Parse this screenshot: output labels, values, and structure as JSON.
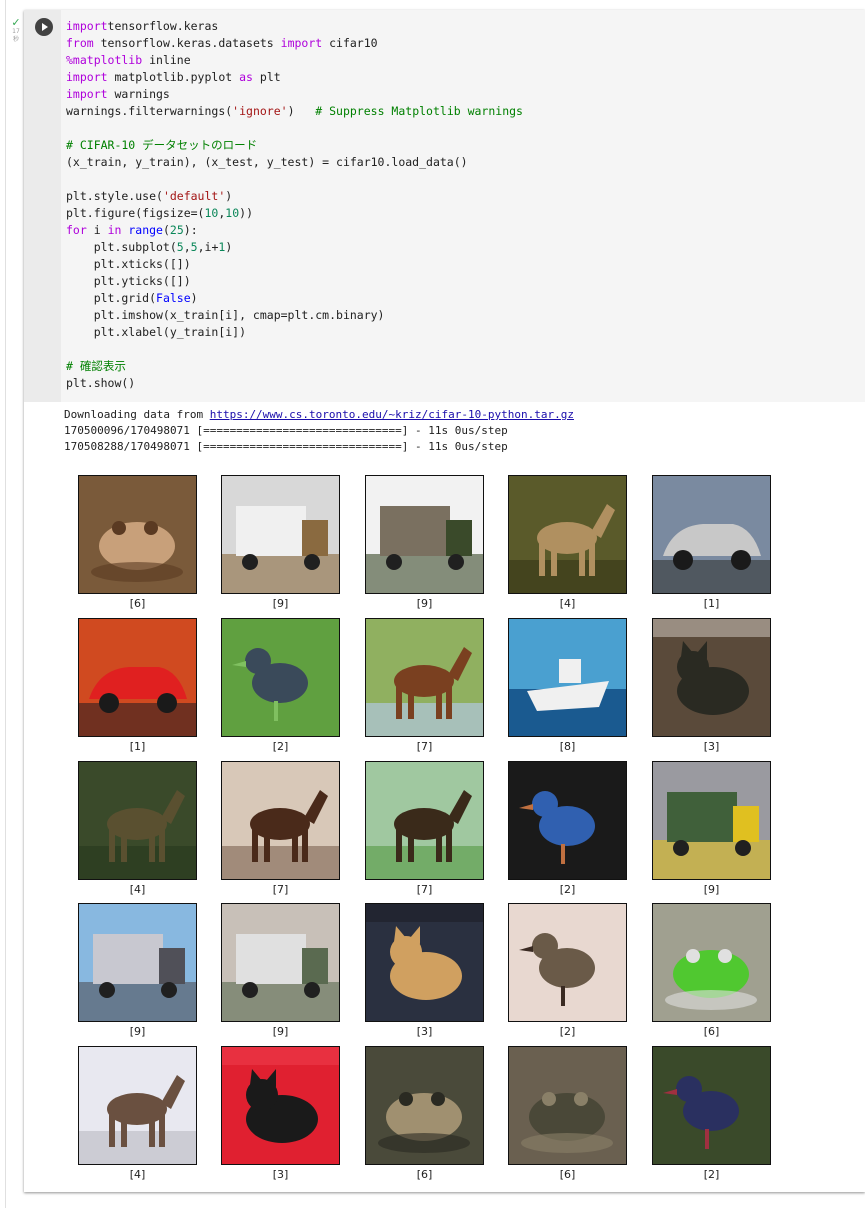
{
  "cell": {
    "status_lines": [
      "17",
      "秒"
    ],
    "code_lines": [
      [
        [
          "kw",
          "import"
        ],
        [
          "",
          "tensorflow.keras"
        ]
      ],
      [
        [
          "kw",
          "from"
        ],
        [
          "",
          " tensorflow.keras.datasets "
        ],
        [
          "kw",
          "import"
        ],
        [
          "",
          " cifar10"
        ]
      ],
      [
        [
          "kw",
          "%matplotlib"
        ],
        [
          "",
          " inline"
        ]
      ],
      [
        [
          "kw",
          "import"
        ],
        [
          "",
          " matplotlib.pyplot "
        ],
        [
          "kw",
          "as"
        ],
        [
          "",
          " plt"
        ]
      ],
      [
        [
          "kw",
          "import"
        ],
        [
          "",
          " warnings"
        ]
      ],
      [
        [
          "",
          "warnings.filterwarnings("
        ],
        [
          "st",
          "'ignore'"
        ],
        [
          "",
          ")   "
        ],
        [
          "cm",
          "# Suppress Matplotlib warnings"
        ]
      ],
      [],
      [
        [
          "cm",
          "# CIFAR-10 データセットのロード"
        ]
      ],
      [
        [
          "",
          "(x_train, y_train), (x_test, y_test) = cifar10.load_data()"
        ]
      ],
      [],
      [
        [
          "",
          "plt.style.use("
        ],
        [
          "st",
          "'default'"
        ],
        [
          "",
          ")"
        ]
      ],
      [
        [
          "",
          "plt.figure(figsize=("
        ],
        [
          "nm",
          "10"
        ],
        [
          "",
          ","
        ],
        [
          "nm",
          "10"
        ],
        [
          "",
          "))"
        ]
      ],
      [
        [
          "kw",
          "for"
        ],
        [
          "",
          " i "
        ],
        [
          "kw",
          "in"
        ],
        [
          "",
          " "
        ],
        [
          "kw2",
          "range"
        ],
        [
          "",
          "("
        ],
        [
          "nm",
          "25"
        ],
        [
          "",
          "):"
        ]
      ],
      [
        [
          "",
          "    plt.subplot("
        ],
        [
          "nm",
          "5"
        ],
        [
          "",
          ","
        ],
        [
          "nm",
          "5"
        ],
        [
          "",
          ",i+"
        ],
        [
          "nm",
          "1"
        ],
        [
          "",
          ")"
        ]
      ],
      [
        [
          "",
          "    plt.xticks([])"
        ]
      ],
      [
        [
          "",
          "    plt.yticks([])"
        ]
      ],
      [
        [
          "",
          "    plt.grid("
        ],
        [
          "kw2",
          "False"
        ],
        [
          "",
          ")"
        ]
      ],
      [
        [
          "",
          "    plt.imshow(x_train[i], cmap=plt.cm.binary)"
        ]
      ],
      [
        [
          "",
          "    plt.xlabel(y_train[i])"
        ]
      ],
      [],
      [
        [
          "cm",
          "# 確認表示"
        ]
      ],
      [
        [
          "",
          "plt.show()"
        ]
      ]
    ]
  },
  "output": {
    "download_prefix": "Downloading data from ",
    "download_url": "https://www.cs.toronto.edu/~kriz/cifar-10-python.tar.gz",
    "progress_lines": [
      "170500096/170498071 [==============================] - 11s 0us/step",
      "170508288/170498071 [==============================] - 11s 0us/step"
    ]
  },
  "images": [
    {
      "label": "[6]",
      "subject": "frog",
      "bg": "#7a5a3a",
      "fg": "#c8a07a",
      "accent": "#5a3a22"
    },
    {
      "label": "[9]",
      "subject": "truck",
      "bg": "#d8d8d8",
      "fg": "#f0f0f0",
      "accent": "#8a6a40"
    },
    {
      "label": "[9]",
      "subject": "truck",
      "bg": "#f2f2f2",
      "fg": "#7a7060",
      "accent": "#3a4a2a"
    },
    {
      "label": "[4]",
      "subject": "deer",
      "bg": "#5a5a2a",
      "fg": "#b09060",
      "accent": "#3a3a1a"
    },
    {
      "label": "[1]",
      "subject": "automobile",
      "bg": "#7a8aa0",
      "fg": "#c8c8c8",
      "accent": "#505860"
    },
    {
      "label": "[1]",
      "subject": "automobile",
      "bg": "#d04a20",
      "fg": "#e02020",
      "accent": "#703020"
    },
    {
      "label": "[2]",
      "subject": "bird",
      "bg": "#60a040",
      "fg": "#3a4a5a",
      "accent": "#80c060"
    },
    {
      "label": "[7]",
      "subject": "horse",
      "bg": "#90b060",
      "fg": "#7a4020",
      "accent": "#b0c8e0"
    },
    {
      "label": "[8]",
      "subject": "ship",
      "bg": "#4aa0d0",
      "fg": "#f0f0f0",
      "accent": "#1a5a90"
    },
    {
      "label": "[3]",
      "subject": "cat",
      "bg": "#5a4a3a",
      "fg": "#2a2a22",
      "accent": "#d8d0c8"
    },
    {
      "label": "[4]",
      "subject": "deer",
      "bg": "#3a4a2a",
      "fg": "#5a5030",
      "accent": "#2a3a20"
    },
    {
      "label": "[7]",
      "subject": "horse",
      "bg": "#d8c8b8",
      "fg": "#4a2a1a",
      "accent": "#8a7060"
    },
    {
      "label": "[7]",
      "subject": "horse",
      "bg": "#a0c8a0",
      "fg": "#3a2a1a",
      "accent": "#60a050"
    },
    {
      "label": "[2]",
      "subject": "bird",
      "bg": "#1a1a1a",
      "fg": "#3060b0",
      "accent": "#c07040"
    },
    {
      "label": "[9]",
      "subject": "truck",
      "bg": "#9a9aa0",
      "fg": "#40603a",
      "accent": "#e0c020"
    },
    {
      "label": "[9]",
      "subject": "truck",
      "bg": "#88b8e0",
      "fg": "#c8c8d0",
      "accent": "#505058"
    },
    {
      "label": "[9]",
      "subject": "truck",
      "bg": "#c8c0b8",
      "fg": "#e0e0e0",
      "accent": "#5a6a50"
    },
    {
      "label": "[3]",
      "subject": "cat",
      "bg": "#2a3040",
      "fg": "#d0a060",
      "accent": "#1a1a22"
    },
    {
      "label": "[2]",
      "subject": "bird",
      "bg": "#e8d8d0",
      "fg": "#6a5a48",
      "accent": "#3a2a22"
    },
    {
      "label": "[6]",
      "subject": "frog",
      "bg": "#a0a090",
      "fg": "#50c830",
      "accent": "#e0e0e0"
    },
    {
      "label": "[4]",
      "subject": "deer",
      "bg": "#e8e8f0",
      "fg": "#6a5040",
      "accent": "#c0c0c8"
    },
    {
      "label": "[3]",
      "subject": "cat",
      "bg": "#e02030",
      "fg": "#1a1a1a",
      "accent": "#f04050"
    },
    {
      "label": "[6]",
      "subject": "frog",
      "bg": "#4a4a3a",
      "fg": "#a09070",
      "accent": "#2a2a22"
    },
    {
      "label": "[6]",
      "subject": "frog",
      "bg": "#6a6050",
      "fg": "#4a4838",
      "accent": "#8a8068"
    },
    {
      "label": "[2]",
      "subject": "bird",
      "bg": "#3a4a2a",
      "fg": "#2a3060",
      "accent": "#a03040"
    }
  ]
}
